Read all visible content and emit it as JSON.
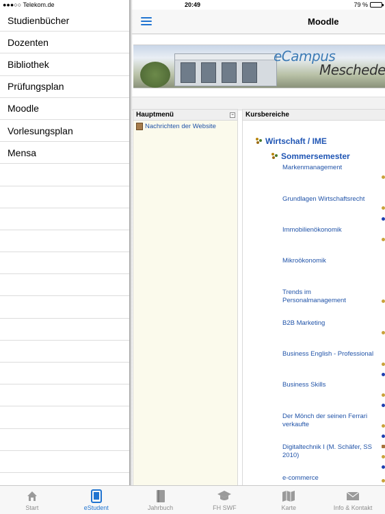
{
  "statusbar": {
    "carrier": "●●●○○ Telekom.de",
    "time": "20:49",
    "battery": "79 %",
    "battery_level": 0.79
  },
  "sidemenu": {
    "items": [
      "Studienbücher",
      "Dozenten",
      "Bibliothek",
      "Prüfungsplan",
      "Moodle",
      "Vorlesungsplan",
      "Mensa"
    ]
  },
  "navbar": {
    "title": "Moodle"
  },
  "banner": {
    "brand_line1": "eCampus",
    "brand_line2": "Meschede"
  },
  "left_block": {
    "title": "Hauptmenü",
    "link": "Nachrichten der Website",
    "collapse_glyph": "−"
  },
  "right_block": {
    "title": "Kursbereiche",
    "category": "Wirtschaft / IME",
    "subcategory": "Sommersemester",
    "courses": [
      "Markenmanagement",
      "Grundlagen Wirtschaftsrecht",
      "Immobilienökonomik",
      "Mikroökonomik",
      "Trends im Personalmanagement",
      "B2B Marketing",
      "Business English - Professional",
      "Business Skills",
      "Der Mönch der seinen Ferrari verkaufte",
      "Digitaltechnik I (M. Schäfer, SS 2010)",
      "e-commerce"
    ]
  },
  "tabbar": {
    "tabs": [
      {
        "label": "Start",
        "icon": "house-icon"
      },
      {
        "label": "eStudent",
        "icon": "tablet-icon"
      },
      {
        "label": "Jahrbuch",
        "icon": "book-icon"
      },
      {
        "label": "FH SWF",
        "icon": "graduation-cap-icon"
      },
      {
        "label": "Karte",
        "icon": "map-icon"
      },
      {
        "label": "Info & Kontakt",
        "icon": "envelope-icon"
      }
    ],
    "active": "eStudent"
  },
  "colors": {
    "accent": "#1f73d0",
    "link": "#2053a8",
    "category": "#1f55b4"
  }
}
